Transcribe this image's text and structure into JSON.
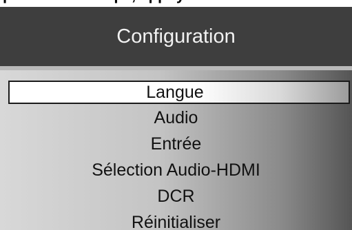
{
  "top_caption": "pendant ce temps, appuyez sur la touche MENU du ...",
  "menu": {
    "title": "Configuration",
    "selected_index": 0,
    "items": [
      {
        "label": "Langue"
      },
      {
        "label": "Audio"
      },
      {
        "label": "Entrée"
      },
      {
        "label": "Sélection Audio-HDMI"
      },
      {
        "label": "DCR"
      },
      {
        "label": "Réinitialiser"
      }
    ]
  },
  "colors": {
    "header_bg": "#3e3e3e",
    "header_text": "#f2f2f2",
    "body_gradient_start": "#d8d8d8",
    "body_gradient_end": "#555555",
    "selection_border": "#1a1a1a"
  }
}
